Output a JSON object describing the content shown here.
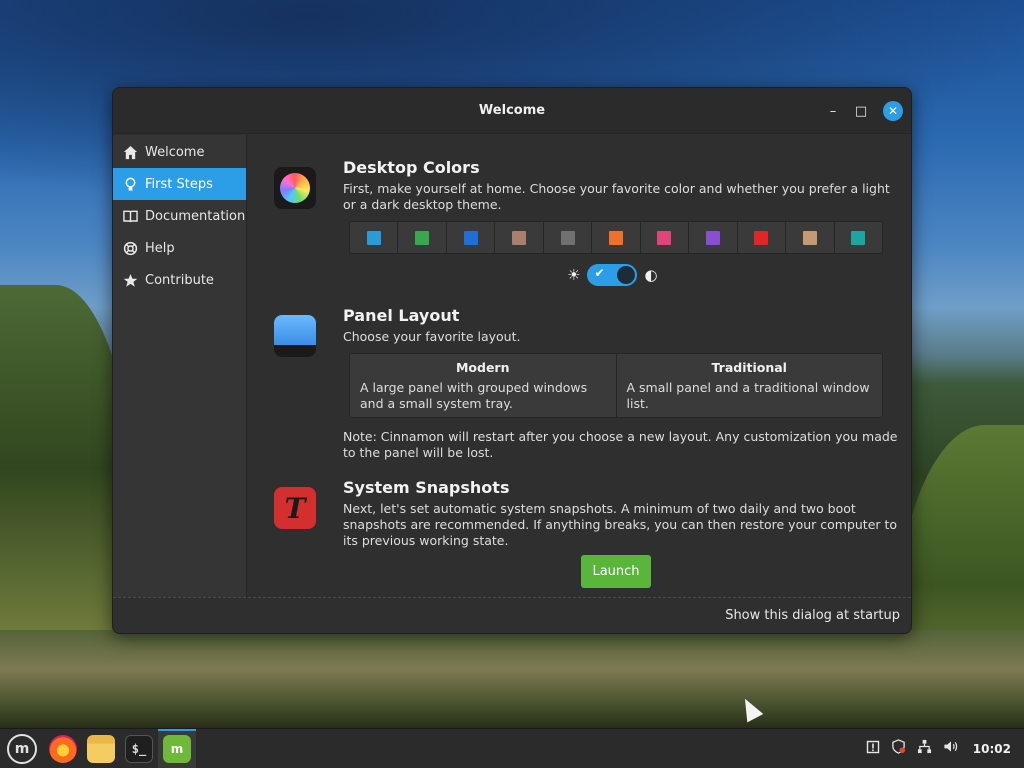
{
  "window": {
    "title": "Welcome",
    "controls": {
      "minimize": "–",
      "maximize": "□",
      "close": "✕"
    }
  },
  "sidebar": {
    "items": [
      {
        "label": "Welcome",
        "icon": "home-icon",
        "active": false
      },
      {
        "label": "First Steps",
        "icon": "lightbulb-icon",
        "active": true
      },
      {
        "label": "Documentation",
        "icon": "book-icon",
        "active": false
      },
      {
        "label": "Help",
        "icon": "lifebuoy-icon",
        "active": false
      },
      {
        "label": "Contribute",
        "icon": "star-icon",
        "active": false
      }
    ]
  },
  "sections": {
    "colors": {
      "title": "Desktop Colors",
      "text": "First, make yourself at home. Choose your favorite color and whether you prefer a light or a dark desktop theme.",
      "swatches": [
        "#2a9ad8",
        "#37a84b",
        "#1f6fd6",
        "#a8806c",
        "#707070",
        "#f0702a",
        "#e0447a",
        "#8a4ed0",
        "#e02626",
        "#c49a72",
        "#1ea59f"
      ],
      "theme_toggle": {
        "on": true
      }
    },
    "layout": {
      "title": "Panel Layout",
      "text": "Choose your favorite layout.",
      "options": [
        {
          "name": "Modern",
          "desc": "A large panel with grouped windows and a small system tray."
        },
        {
          "name": "Traditional",
          "desc": "A small panel and a traditional window list."
        }
      ],
      "note": "Note: Cinnamon will restart after you choose a new layout. Any customization you made to the panel will be lost."
    },
    "snapshots": {
      "title": "System Snapshots",
      "text": "Next, let's set automatic system snapshots. A minimum of two daily and two boot snapshots are recommended. If anything breaks, you can then restore your computer to its previous working state.",
      "button": "Launch"
    }
  },
  "footer": {
    "label": "Show this dialog at startup"
  },
  "taskbar": {
    "apps": [
      "menu",
      "firefox",
      "files",
      "terminal",
      "welcome"
    ],
    "clock": "10:02"
  },
  "colors": {
    "accent": "#2c9ee8",
    "launch": "#5ab53b"
  }
}
